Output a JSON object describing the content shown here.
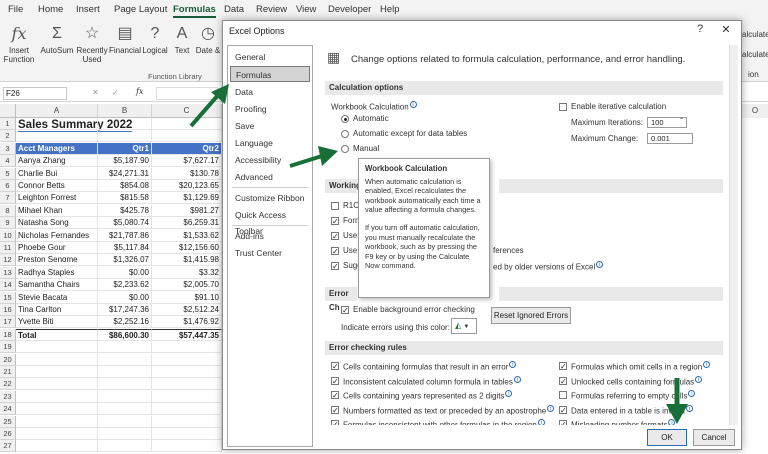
{
  "menubar": [
    "File",
    "Home",
    "Insert",
    "Page Layout",
    "Formulas",
    "Data",
    "Review",
    "View",
    "Developer",
    "Help"
  ],
  "ribbon": {
    "buttons": [
      "Insert Function",
      "AutoSum",
      "Recently Used",
      "Financial",
      "Logical",
      "Text",
      "Date &",
      "Time"
    ],
    "group": "Function Library",
    "right_labels": [
      "alculate",
      "alculate",
      "ion"
    ]
  },
  "formula_bar": {
    "namebox": "F26",
    "fx": "fx"
  },
  "sheet": {
    "col_headers": [
      "A",
      "B",
      "C"
    ],
    "title": "Sales Summary 2022",
    "table_headers": [
      "Acct Managers",
      "Qtr1",
      "Qtr2"
    ],
    "rows": [
      [
        "Aanya Zhang",
        "$5,187.90",
        "$7,627.17"
      ],
      [
        "Charlie Bui",
        "$24,271.31",
        "$130.78"
      ],
      [
        "Connor Betts",
        "$854.08",
        "$20,123.65"
      ],
      [
        "Leighton Forrest",
        "$815.58",
        "$1,129.69"
      ],
      [
        "Mihael Khan",
        "$425.78",
        "$981.27"
      ],
      [
        "Natasha Song",
        "$5,080.74",
        "$6,259.31"
      ],
      [
        "Nicholas Fernandes",
        "$21,787.86",
        "$1,533.62"
      ],
      [
        "Phoebe Gour",
        "$5,117.84",
        "$12,156.60"
      ],
      [
        "Preston Senome",
        "$1,326.07",
        "$1,415.98"
      ],
      [
        "Radhya Staples",
        "$0.00",
        "$3.32"
      ],
      [
        "Samantha Chairs",
        "$2,233.62",
        "$2,005.70"
      ],
      [
        "Stevie Bacata",
        "$0.00",
        "$91.10"
      ],
      [
        "Tina Carlton",
        "$17,247.36",
        "$2,512.24"
      ],
      [
        "Yvette Biti",
        "$2,252.16",
        "$1,476.92"
      ]
    ],
    "total": [
      "Total",
      "$86,600.30",
      "$57,447.35"
    ],
    "row_numbers": [
      "1",
      "2",
      "3",
      "4",
      "5",
      "6",
      "7",
      "8",
      "9",
      "10",
      "11",
      "12",
      "13",
      "14",
      "15",
      "16",
      "17",
      "18",
      "19",
      "20",
      "21",
      "22",
      "23",
      "24",
      "25",
      "26",
      "27"
    ],
    "right_col": "O"
  },
  "dialog": {
    "title": "Excel Options",
    "help": "?",
    "close": "✕",
    "nav": [
      "General",
      "Formulas",
      "Data",
      "Proofing",
      "Save",
      "Language",
      "Accessibility",
      "Advanced",
      "Customize Ribbon",
      "Quick Access Toolbar",
      "Add-ins",
      "Trust Center"
    ],
    "header": "Change options related to formula calculation, performance, and error handling.",
    "calc": {
      "section": "Calculation options",
      "workbook_label": "Workbook Calculation",
      "automatic": "Automatic",
      "auto_except": "Automatic except for data tables",
      "manual": "Manual",
      "iterative": "Enable iterative calculation",
      "max_iter_label": "Maximum Iterations:",
      "max_iter": "100",
      "max_change_label": "Maximum Change:",
      "max_change": "0.001"
    },
    "working": {
      "section": "Working",
      "items": [
        "R1C",
        "Form",
        "Use",
        "Use",
        "Sugg"
      ],
      "tail1": "ferences",
      "tail2": "ed by older versions of Excel"
    },
    "tooltip": {
      "title": "Workbook Calculation",
      "p1": "When automatic calculation is enabled, Excel recalculates the workbook automatically each time a value affecting a formula changes.",
      "p2": "If you turn off automatic calculation, you must manually recalculate the workbook, such as by pressing the F9 key or by using the Calculate Now command."
    },
    "errcheck": {
      "section": "Error Ch",
      "enable": "Enable background error checking",
      "indicate": "Indicate errors using this color:",
      "reset": "Reset Ignored Errors"
    },
    "rules": {
      "section": "Error checking rules",
      "left": [
        "Cells containing formulas that result in an error",
        "Inconsistent calculated column formula in tables",
        "Cells containing years represented as 2 digits",
        "Numbers formatted as text or preceded by an apostrophe",
        "Formulas inconsistent with other formulas in the region"
      ],
      "right": [
        "Formulas which omit cells in a region",
        "Unlocked cells containing formulas",
        "Formulas referring to empty cells",
        "Data entered in a table is invalid",
        "Misleading number formats"
      ]
    },
    "ok": "OK",
    "cancel": "Cancel"
  },
  "colors": {
    "accent": "#185c37",
    "table_header": "#4472c4",
    "arrow": "#187038"
  }
}
